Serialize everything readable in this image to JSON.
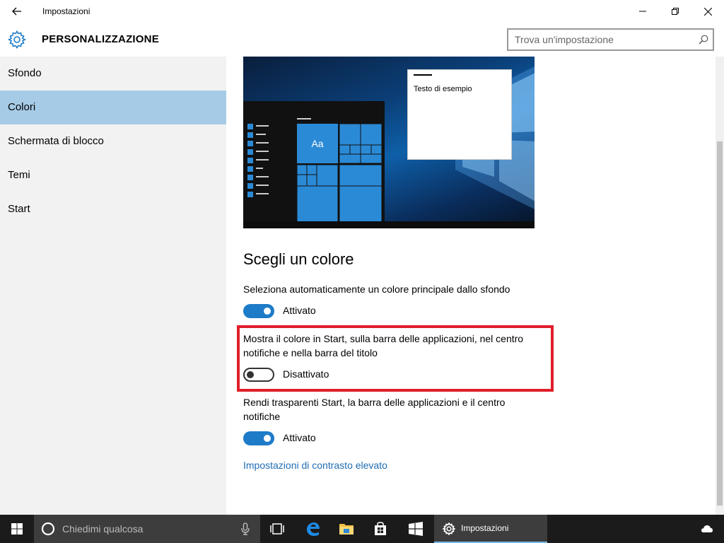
{
  "window": {
    "title": "Impostazioni"
  },
  "header": {
    "title": "PERSONALIZZAZIONE",
    "search_placeholder": "Trova un'impostazione"
  },
  "sidebar": {
    "items": [
      {
        "label": "Sfondo",
        "active": false
      },
      {
        "label": "Colori",
        "active": true
      },
      {
        "label": "Schermata di blocco",
        "active": false
      },
      {
        "label": "Temi",
        "active": false
      },
      {
        "label": "Start",
        "active": false
      }
    ]
  },
  "preview": {
    "tile_label": "Aa",
    "sample_text": "Testo di esempio"
  },
  "content": {
    "section_title": "Scegli un colore",
    "settings": [
      {
        "label": "Seleziona automaticamente un colore principale dallo sfondo",
        "state": "Attivato",
        "on": true
      },
      {
        "label": "Mostra il colore in Start, sulla barra delle applicazioni, nel centro notifiche e nella barra del titolo",
        "state": "Disattivato",
        "on": false
      },
      {
        "label": "Rendi trasparenti Start, la barra delle applicazioni e il centro notifiche",
        "state": "Attivato",
        "on": true
      }
    ],
    "link": "Impostazioni di contrasto elevato"
  },
  "taskbar": {
    "search_placeholder": "Chiedimi qualcosa",
    "active_app": "Impostazioni"
  },
  "colors": {
    "accent": "#1e7bc8",
    "sidebar_active": "#a6cbe6",
    "highlight": "#e01e2a",
    "link": "#1f6cb3"
  }
}
